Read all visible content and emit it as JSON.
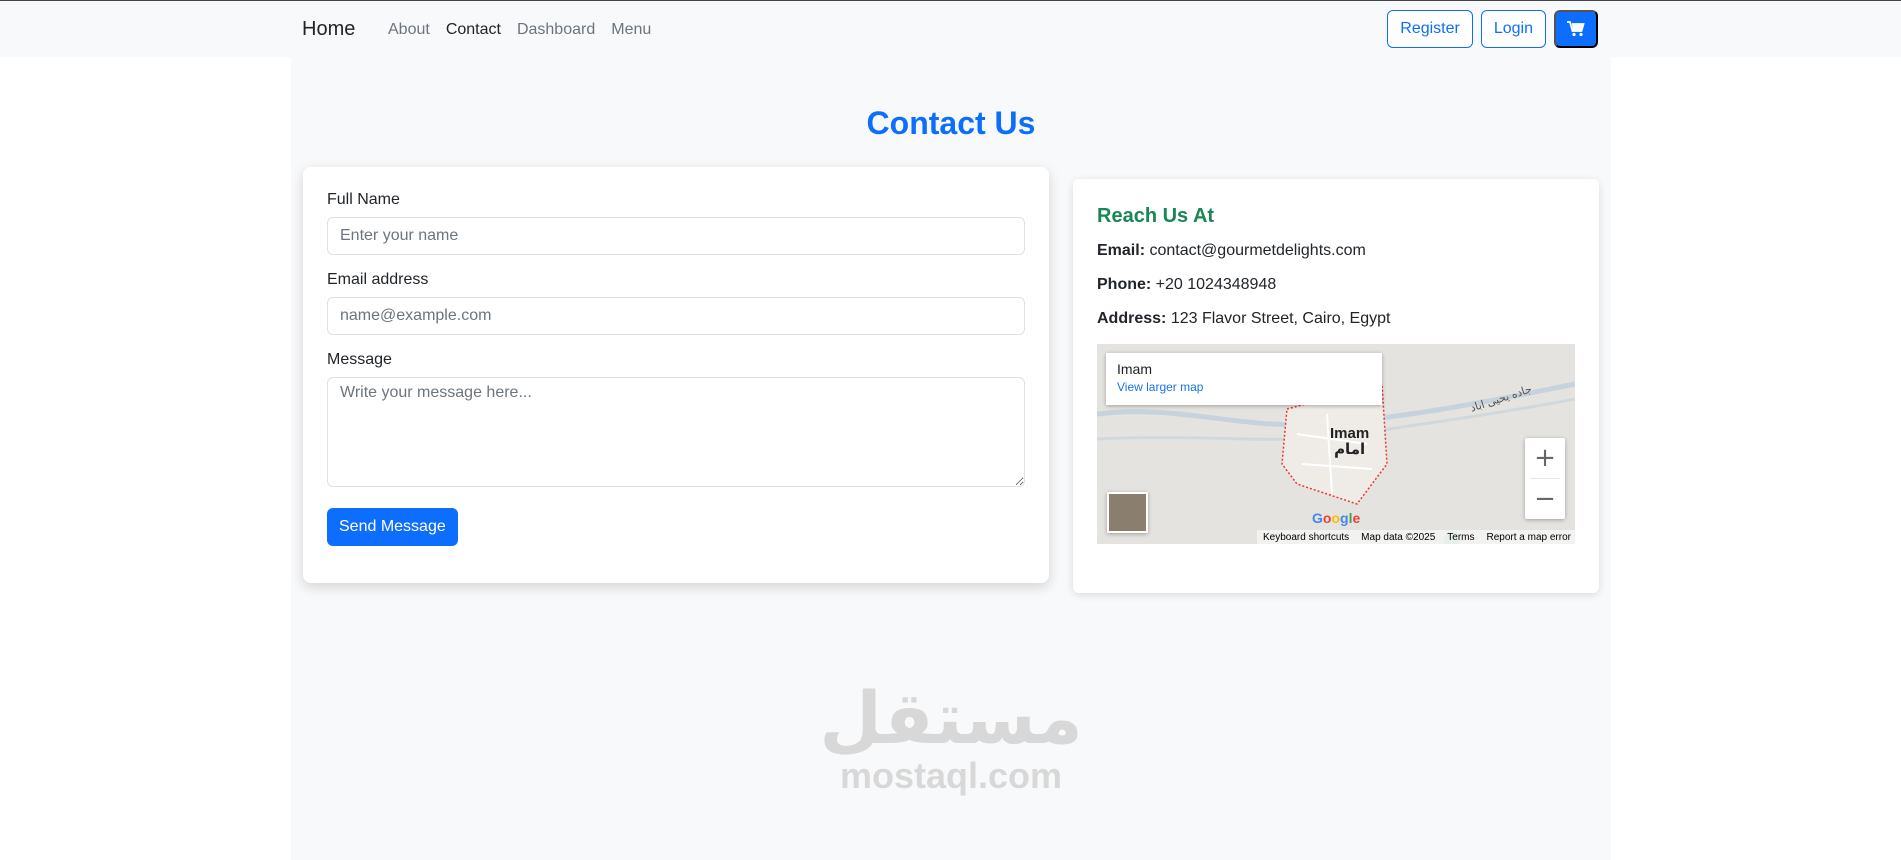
{
  "nav": {
    "brand": "Home",
    "links": [
      {
        "label": "About"
      },
      {
        "label": "Contact"
      },
      {
        "label": "Dashboard"
      },
      {
        "label": "Menu"
      }
    ],
    "register_label": "Register",
    "login_label": "Login",
    "cart_icon": "cart-icon"
  },
  "page": {
    "title": "Contact Us"
  },
  "form": {
    "name_label": "Full Name",
    "name_placeholder": "Enter your name",
    "email_label": "Email address",
    "email_placeholder": "name@example.com",
    "message_label": "Message",
    "message_placeholder": "Write your message here...",
    "submit_label": "Send Message"
  },
  "info": {
    "title": "Reach Us At",
    "email_label": "Email:",
    "email_value": "contact@gourmetdelights.com",
    "phone_label": "Phone:",
    "phone_value": "+20 1024348948",
    "address_label": "Address:",
    "address_value": "123 Flavor Street, Cairo, Egypt"
  },
  "map": {
    "place": "Imam",
    "larger_map": "View larger map",
    "label_en": "Imam",
    "label_ar": "امام",
    "road_label": "جاده یحیی اباد",
    "zoom_in": "+",
    "zoom_out": "−",
    "footer": [
      "Keyboard shortcuts",
      "Map data ©2025",
      "Terms",
      "Report a map error"
    ]
  },
  "watermark": {
    "arabic": "مستقل",
    "latin": "mostaql.com"
  },
  "colors": {
    "primary": "#0d6efd",
    "success": "#198754"
  }
}
